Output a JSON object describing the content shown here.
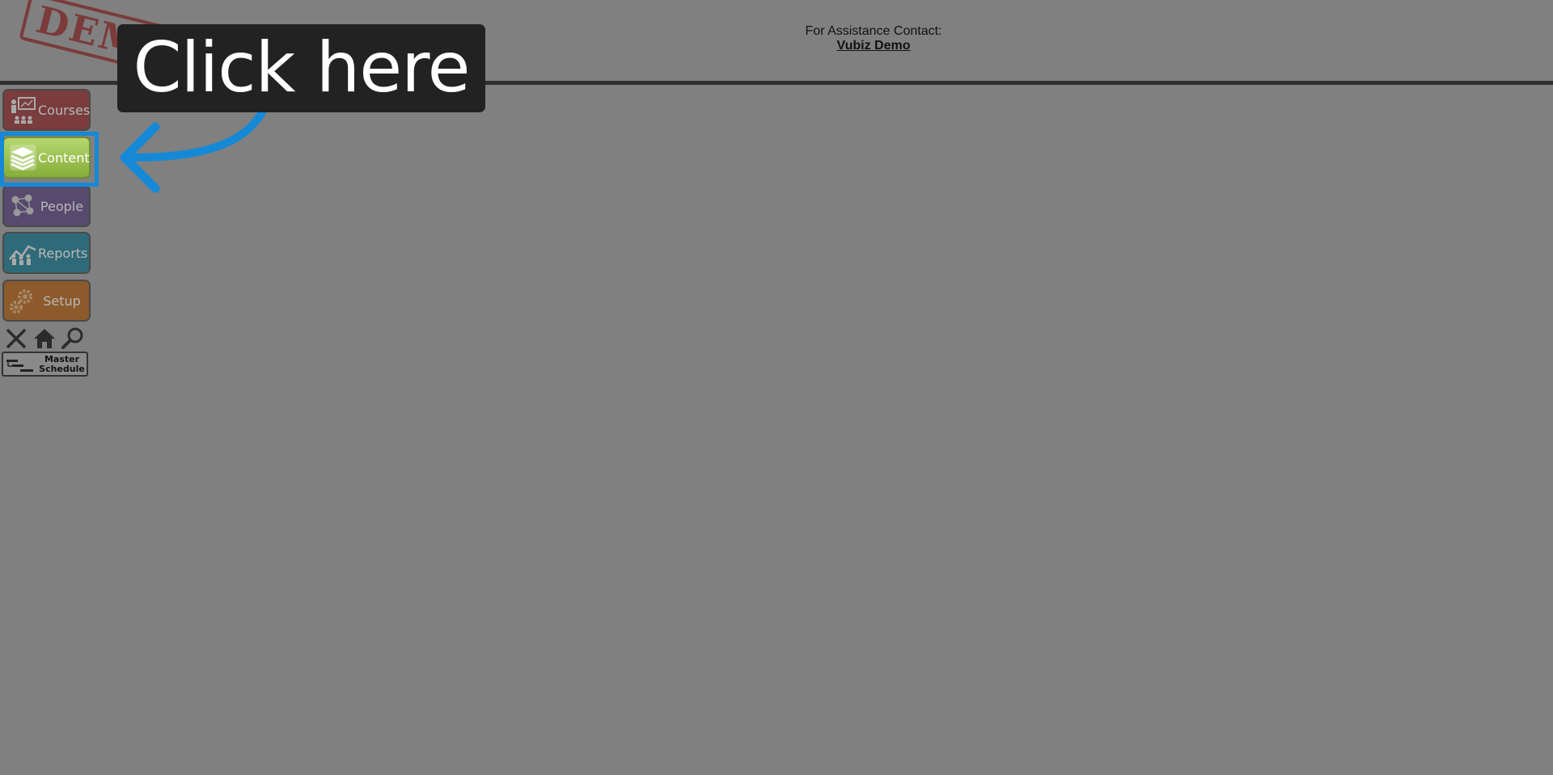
{
  "header": {
    "assistance_label": "For Assistance Contact:",
    "contact_link": "Vubiz Demo",
    "stamp_text": "DEMO"
  },
  "tooltip": {
    "text": "Click here"
  },
  "colors": {
    "highlight": "#1689d6",
    "tooltip_bg": "#222222",
    "overlay_bg": "#808080"
  },
  "nav": {
    "items": [
      {
        "label": "Courses",
        "icon": "presenter-icon"
      },
      {
        "label": "Content",
        "icon": "stack-icon"
      },
      {
        "label": "People",
        "icon": "network-icon"
      },
      {
        "label": "Reports",
        "icon": "chart-people-icon"
      },
      {
        "label": "Setup",
        "icon": "gears-icon"
      }
    ]
  },
  "tools": {
    "icons": [
      "close-icon",
      "home-icon",
      "search-icon"
    ]
  },
  "schedule": {
    "label": "Master\nSchedule",
    "icon": "gantt-icon"
  }
}
